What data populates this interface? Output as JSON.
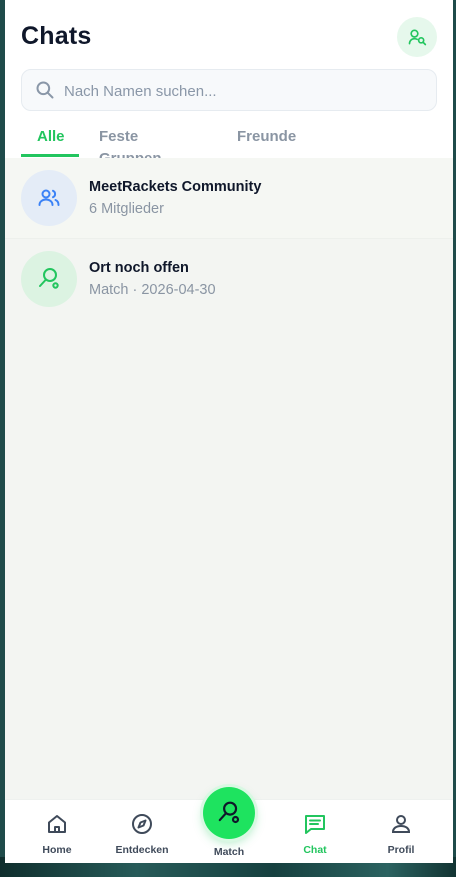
{
  "header": {
    "title": "Chats",
    "action_icon": "user-search-icon"
  },
  "search": {
    "placeholder": "Nach Namen suchen...",
    "value": ""
  },
  "tabs": [
    {
      "label": "Alle",
      "active": true
    },
    {
      "label": "Feste Gruppen",
      "active": false
    },
    {
      "label": "Freunde",
      "active": false
    }
  ],
  "chats": [
    {
      "name": "MeetRackets Community",
      "subtitle": "6 Mitglieder",
      "icon": "users-icon"
    },
    {
      "name": "Ort noch offen",
      "subtitle": "Match · 2026-04-30",
      "icon": "racket-icon"
    }
  ],
  "nav": {
    "items": [
      {
        "label": "Home",
        "icon": "home-icon"
      },
      {
        "label": "Entdecken",
        "icon": "compass-icon"
      },
      {
        "label": "Match",
        "icon": "racket-icon"
      },
      {
        "label": "Chat",
        "icon": "chat-icon",
        "active": true
      },
      {
        "label": "Profil",
        "icon": "user-icon"
      }
    ]
  },
  "colors": {
    "accent": "#22c55e",
    "fab": "#1ee35f",
    "text": "#0f172a",
    "muted": "#8a95a3"
  }
}
